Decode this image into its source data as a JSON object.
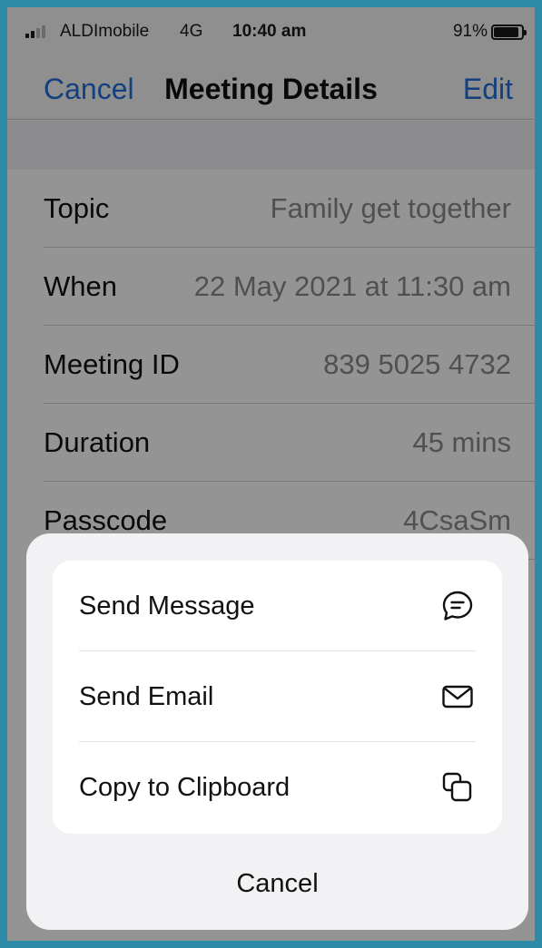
{
  "status_bar": {
    "carrier": "ALDImobile",
    "network": "4G",
    "time": "10:40 am",
    "battery_percent": "91%",
    "battery_level": 0.91,
    "signal_bars_active": 2,
    "signal_bars_total": 4
  },
  "nav": {
    "cancel_label": "Cancel",
    "title": "Meeting Details",
    "edit_label": "Edit"
  },
  "details": [
    {
      "label": "Topic",
      "value": "Family get together"
    },
    {
      "label": "When",
      "value": "22 May 2021 at 11:30 am"
    },
    {
      "label": "Meeting ID",
      "value": "839 5025 4732"
    },
    {
      "label": "Duration",
      "value": "45 mins"
    },
    {
      "label": "Passcode",
      "value": "4CsaSm"
    }
  ],
  "action_sheet": {
    "actions": [
      {
        "label": "Send Message",
        "icon": "message-bubble-icon"
      },
      {
        "label": "Send Email",
        "icon": "envelope-icon"
      },
      {
        "label": "Copy to Clipboard",
        "icon": "copy-icon"
      }
    ],
    "cancel_label": "Cancel"
  },
  "colors": {
    "accent": "#1f6fd9",
    "frame": "#2e8aa6"
  }
}
